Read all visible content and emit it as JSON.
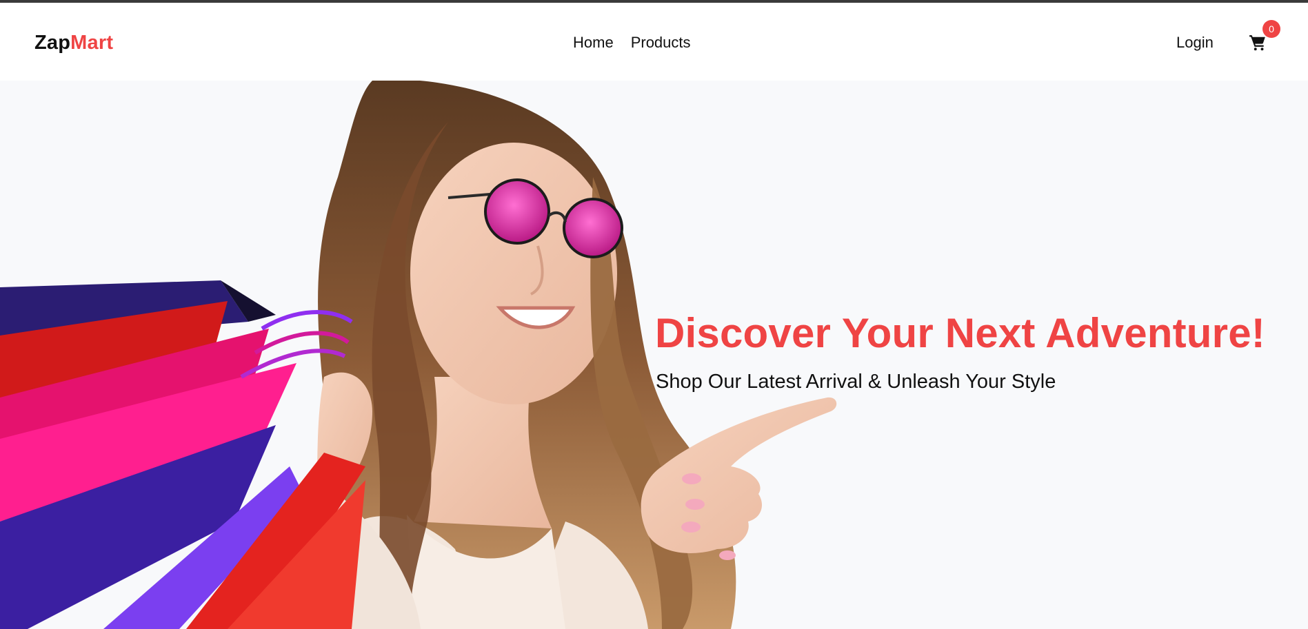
{
  "brand": {
    "part1": "Zap",
    "part2": "Mart",
    "accent_color": "#ef4444"
  },
  "nav": {
    "items": [
      {
        "label": "Home"
      },
      {
        "label": "Products"
      }
    ]
  },
  "header_actions": {
    "login_label": "Login",
    "cart_icon": "shopping-cart-icon",
    "cart_count": "0"
  },
  "hero": {
    "title": "Discover Your Next Adventure!",
    "subtitle": "Shop Our Latest Arrival & Unleash Your Style",
    "image_subject": "smiling woman in pink sunglasses holding colorful shopping bags and pointing right"
  }
}
